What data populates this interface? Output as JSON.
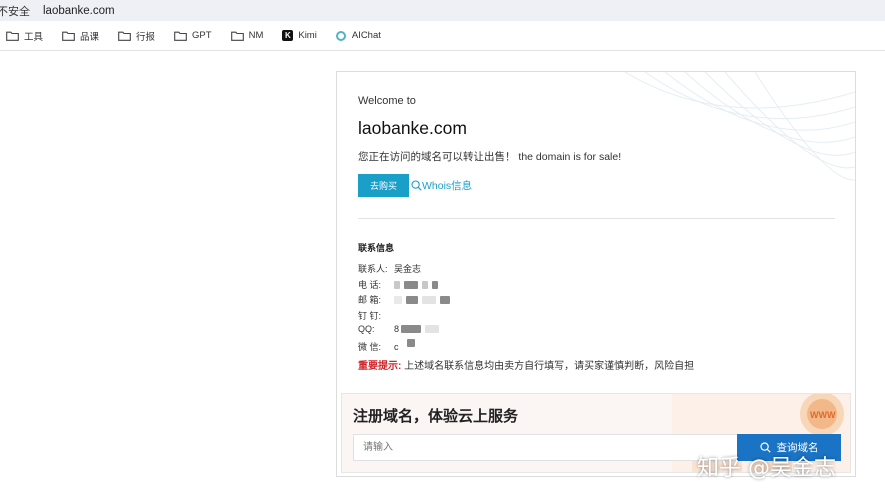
{
  "browser": {
    "security_label": "不安全",
    "url": "laobanke.com"
  },
  "bookmarks": [
    {
      "label": "工具",
      "icon": "folder-icon"
    },
    {
      "label": "品课",
      "icon": "folder-icon"
    },
    {
      "label": "行报",
      "icon": "folder-icon"
    },
    {
      "label": "GPT",
      "icon": "folder-icon"
    },
    {
      "label": "NM",
      "icon": "folder-icon"
    },
    {
      "label": "Kimi",
      "icon": "kimi-icon"
    },
    {
      "label": "AIChat",
      "icon": "aichat-icon"
    }
  ],
  "card": {
    "welcome": "Welcome to",
    "domain": "laobanke.com",
    "sale_text": "您正在访问的域名可以转让出售！  the domain is for sale!",
    "buy_label": "去购买",
    "whois_label": "Whois信息",
    "contact_title": "联系信息",
    "contacts": [
      {
        "label": "联系人:",
        "value": "吴金志"
      },
      {
        "label": "电  话:",
        "value": ""
      },
      {
        "label": "邮  箱:",
        "value": ""
      },
      {
        "label": "钉  钉:",
        "value": ""
      },
      {
        "label": "QQ:",
        "value": "8"
      },
      {
        "label": "微  信:",
        "value": "c"
      }
    ],
    "notice_label": "重要提示:",
    "notice_text": "上述域名联系信息均由卖方自行填写，请买家谨慎判断，风险自担"
  },
  "register": {
    "title": "注册域名，体验云上服务",
    "input_placeholder": "请输入",
    "button_label": "查询域名"
  },
  "watermark": "知乎 @吴金志",
  "colors": {
    "accent": "#1a9fc9",
    "search_button": "#1a73c4",
    "warning": "#d0262b"
  }
}
